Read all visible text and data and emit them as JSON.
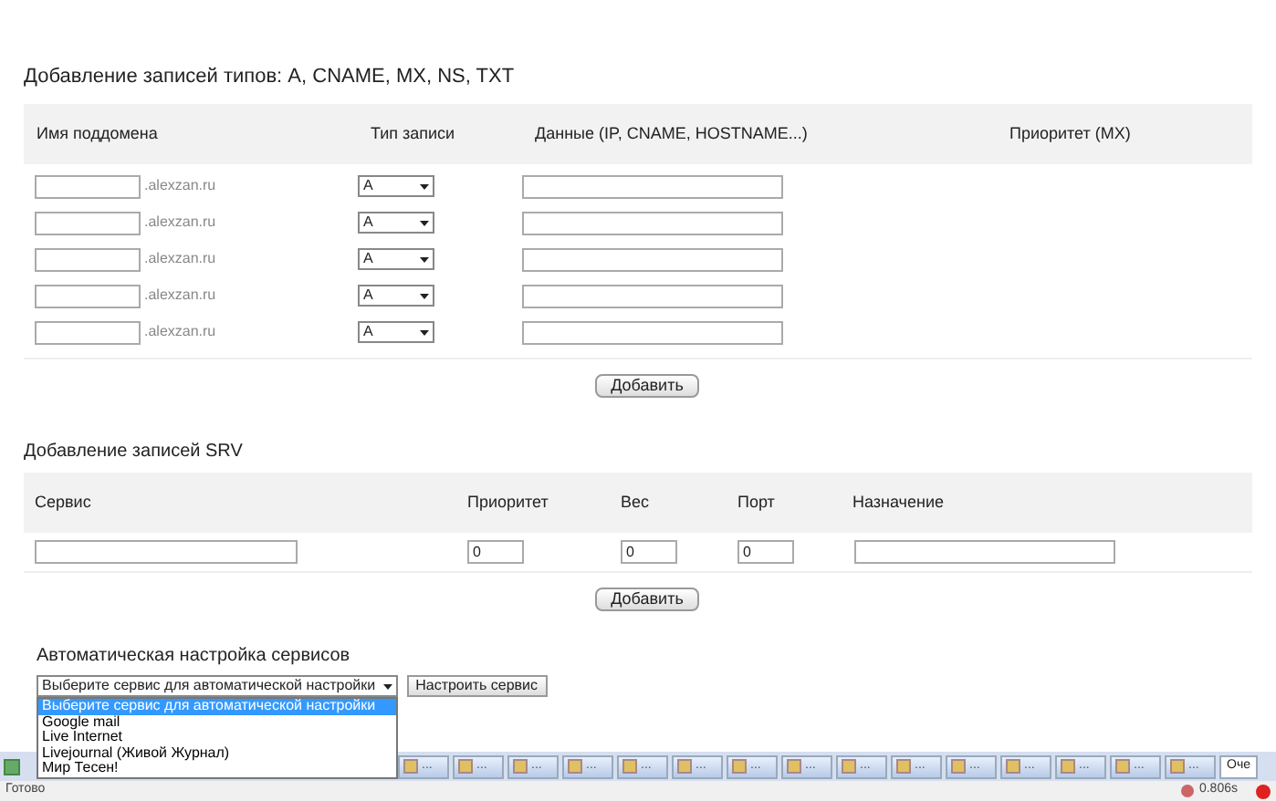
{
  "dns_section": {
    "title": "Добавление записей типов: A, CNAME, MX, NS, TXT",
    "columns": [
      "Имя поддомена",
      "Тип записи",
      "Данные (IP, CNAME, HOSTNAME...)",
      "Приоритет (MX)"
    ],
    "rows": [
      {
        "suffix": ".alexzan.ru",
        "type": "A"
      },
      {
        "suffix": ".alexzan.ru",
        "type": "A"
      },
      {
        "suffix": ".alexzan.ru",
        "type": "A"
      },
      {
        "suffix": ".alexzan.ru",
        "type": "A"
      },
      {
        "suffix": ".alexzan.ru",
        "type": "A"
      }
    ],
    "button": "Добавить"
  },
  "srv_section": {
    "title": "Добавление записей SRV",
    "columns": [
      "Сервис",
      "Приоритет",
      "Вес",
      "Порт",
      "Назначение"
    ],
    "priority": "0",
    "weight": "0",
    "port": "0",
    "button": "Добавить"
  },
  "auto_section": {
    "title": "Автоматическая настройка сервисов",
    "select_value": "Выберите сервис для автоматической настройки",
    "button": "Настроить сервис",
    "options": [
      {
        "label": "Выберите сервис для автоматической настройки",
        "selected": true
      },
      {
        "label": "Google mail",
        "selected": false
      },
      {
        "label": "Live Internet",
        "selected": false
      },
      {
        "label": "Livejournal (Живой Журнал)",
        "selected": false
      },
      {
        "label": "Мир Тесен!",
        "selected": false
      }
    ]
  },
  "taskbar": {
    "items": [
      {
        "label": "..."
      },
      {
        "label": "..."
      },
      {
        "label": "..."
      },
      {
        "label": "..."
      },
      {
        "label": "..."
      },
      {
        "label": "..."
      },
      {
        "label": "..."
      },
      {
        "label": "..."
      },
      {
        "label": "..."
      },
      {
        "label": "..."
      },
      {
        "label": "..."
      },
      {
        "label": "..."
      },
      {
        "label": "..."
      },
      {
        "label": "..."
      },
      {
        "label": "..."
      }
    ],
    "last": "Оче"
  },
  "status_bar": {
    "text": "Готово",
    "timing": "0.806s"
  }
}
